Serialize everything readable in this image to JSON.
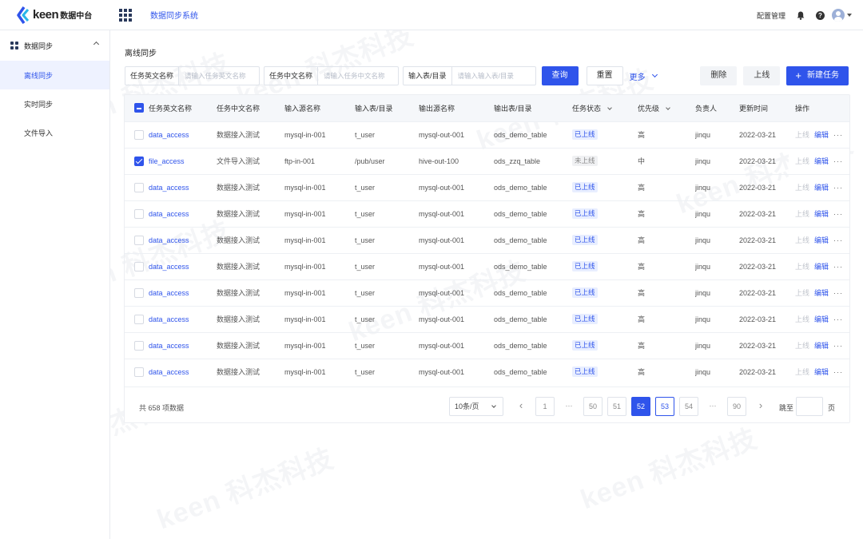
{
  "brand": {
    "logo_text": "keen",
    "logo_sub": "数据中台"
  },
  "header": {
    "system_title": "数据同步系统",
    "config_label": "配置管理",
    "help_label": "?"
  },
  "sidebar": {
    "group_label": "数据同步",
    "items": [
      {
        "label": "离线同步",
        "active": true
      },
      {
        "label": "实时同步",
        "active": false
      },
      {
        "label": "文件导入",
        "active": false
      }
    ]
  },
  "page": {
    "title": "离线同步"
  },
  "filters": {
    "en_name_label": "任务英文名称",
    "en_name_placeholder": "请输入任务英文名称",
    "cn_name_label": "任务中文名称",
    "cn_name_placeholder": "请输入任务中文名称",
    "input_table_label": "输入表/目录",
    "input_table_placeholder": "请输入输入表/目录",
    "query_label": "查询",
    "reset_label": "重置",
    "more_label": "更多"
  },
  "toolbar": {
    "delete_label": "删除",
    "online_label": "上线",
    "new_task_label": "新建任务",
    "plus": "+"
  },
  "table": {
    "headers": [
      "任务英文名称",
      "任务中文名称",
      "输入源名称",
      "输入表/目录",
      "输出源名称",
      "输出表/目录",
      "任务状态",
      "优先级",
      "负责人",
      "更新时间",
      "操作"
    ],
    "rows": [
      {
        "checked": false,
        "en": "data_access",
        "cn": "数据接入测试",
        "in_src": "mysql-in-001",
        "in_tbl": "t_user",
        "out_src": "mysql-out-001",
        "out_tbl": "ods_demo_table",
        "status": "已上线",
        "status_type": "on",
        "priority": "高",
        "owner": "jinqu",
        "updated": "2022-03-21"
      },
      {
        "checked": true,
        "en": "file_access",
        "cn": "文件导入测试",
        "in_src": "ftp-in-001",
        "in_tbl": "/pub/user",
        "out_src": "hive-out-100",
        "out_tbl": "ods_zzq_table",
        "status": "未上线",
        "status_type": "off",
        "priority": "中",
        "owner": "jinqu",
        "updated": "2022-03-21"
      },
      {
        "checked": false,
        "en": "data_access",
        "cn": "数据接入测试",
        "in_src": "mysql-in-001",
        "in_tbl": "t_user",
        "out_src": "mysql-out-001",
        "out_tbl": "ods_demo_table",
        "status": "已上线",
        "status_type": "on",
        "priority": "高",
        "owner": "jinqu",
        "updated": "2022-03-21"
      },
      {
        "checked": false,
        "en": "data_access",
        "cn": "数据接入测试",
        "in_src": "mysql-in-001",
        "in_tbl": "t_user",
        "out_src": "mysql-out-001",
        "out_tbl": "ods_demo_table",
        "status": "已上线",
        "status_type": "on",
        "priority": "高",
        "owner": "jinqu",
        "updated": "2022-03-21"
      },
      {
        "checked": false,
        "en": "data_access",
        "cn": "数据接入测试",
        "in_src": "mysql-in-001",
        "in_tbl": "t_user",
        "out_src": "mysql-out-001",
        "out_tbl": "ods_demo_table",
        "status": "已上线",
        "status_type": "on",
        "priority": "高",
        "owner": "jinqu",
        "updated": "2022-03-21"
      },
      {
        "checked": false,
        "en": "data_access",
        "cn": "数据接入测试",
        "in_src": "mysql-in-001",
        "in_tbl": "t_user",
        "out_src": "mysql-out-001",
        "out_tbl": "ods_demo_table",
        "status": "已上线",
        "status_type": "on",
        "priority": "高",
        "owner": "jinqu",
        "updated": "2022-03-21"
      },
      {
        "checked": false,
        "en": "data_access",
        "cn": "数据接入测试",
        "in_src": "mysql-in-001",
        "in_tbl": "t_user",
        "out_src": "mysql-out-001",
        "out_tbl": "ods_demo_table",
        "status": "已上线",
        "status_type": "on",
        "priority": "高",
        "owner": "jinqu",
        "updated": "2022-03-21"
      },
      {
        "checked": false,
        "en": "data_access",
        "cn": "数据接入测试",
        "in_src": "mysql-in-001",
        "in_tbl": "t_user",
        "out_src": "mysql-out-001",
        "out_tbl": "ods_demo_table",
        "status": "已上线",
        "status_type": "on",
        "priority": "高",
        "owner": "jinqu",
        "updated": "2022-03-21"
      },
      {
        "checked": false,
        "en": "data_access",
        "cn": "数据接入测试",
        "in_src": "mysql-in-001",
        "in_tbl": "t_user",
        "out_src": "mysql-out-001",
        "out_tbl": "ods_demo_table",
        "status": "已上线",
        "status_type": "on",
        "priority": "高",
        "owner": "jinqu",
        "updated": "2022-03-21"
      },
      {
        "checked": false,
        "en": "data_access",
        "cn": "数据接入测试",
        "in_src": "mysql-in-001",
        "in_tbl": "t_user",
        "out_src": "mysql-out-001",
        "out_tbl": "ods_demo_table",
        "status": "已上线",
        "status_type": "on",
        "priority": "高",
        "owner": "jinqu",
        "updated": "2022-03-21"
      }
    ],
    "actions": {
      "online": "上线",
      "edit": "编辑",
      "more": "···"
    }
  },
  "pagination": {
    "total_text": "共 658 项数据",
    "page_size": "10条/页",
    "prev": "‹",
    "next": "›",
    "ellipsis": "···",
    "pages": [
      "1",
      "50",
      "51",
      "52",
      "53",
      "54",
      "90"
    ],
    "current_page": "52",
    "jump_label": "跳至",
    "jump_unit": "页"
  },
  "watermark": {
    "text": "keen 科杰科技"
  },
  "colors": {
    "accent": "#2f54eb",
    "status_on_bg": "#e8eeff",
    "status_off_bg": "#f0f1f3",
    "header_bg": "#f5f7fa"
  }
}
